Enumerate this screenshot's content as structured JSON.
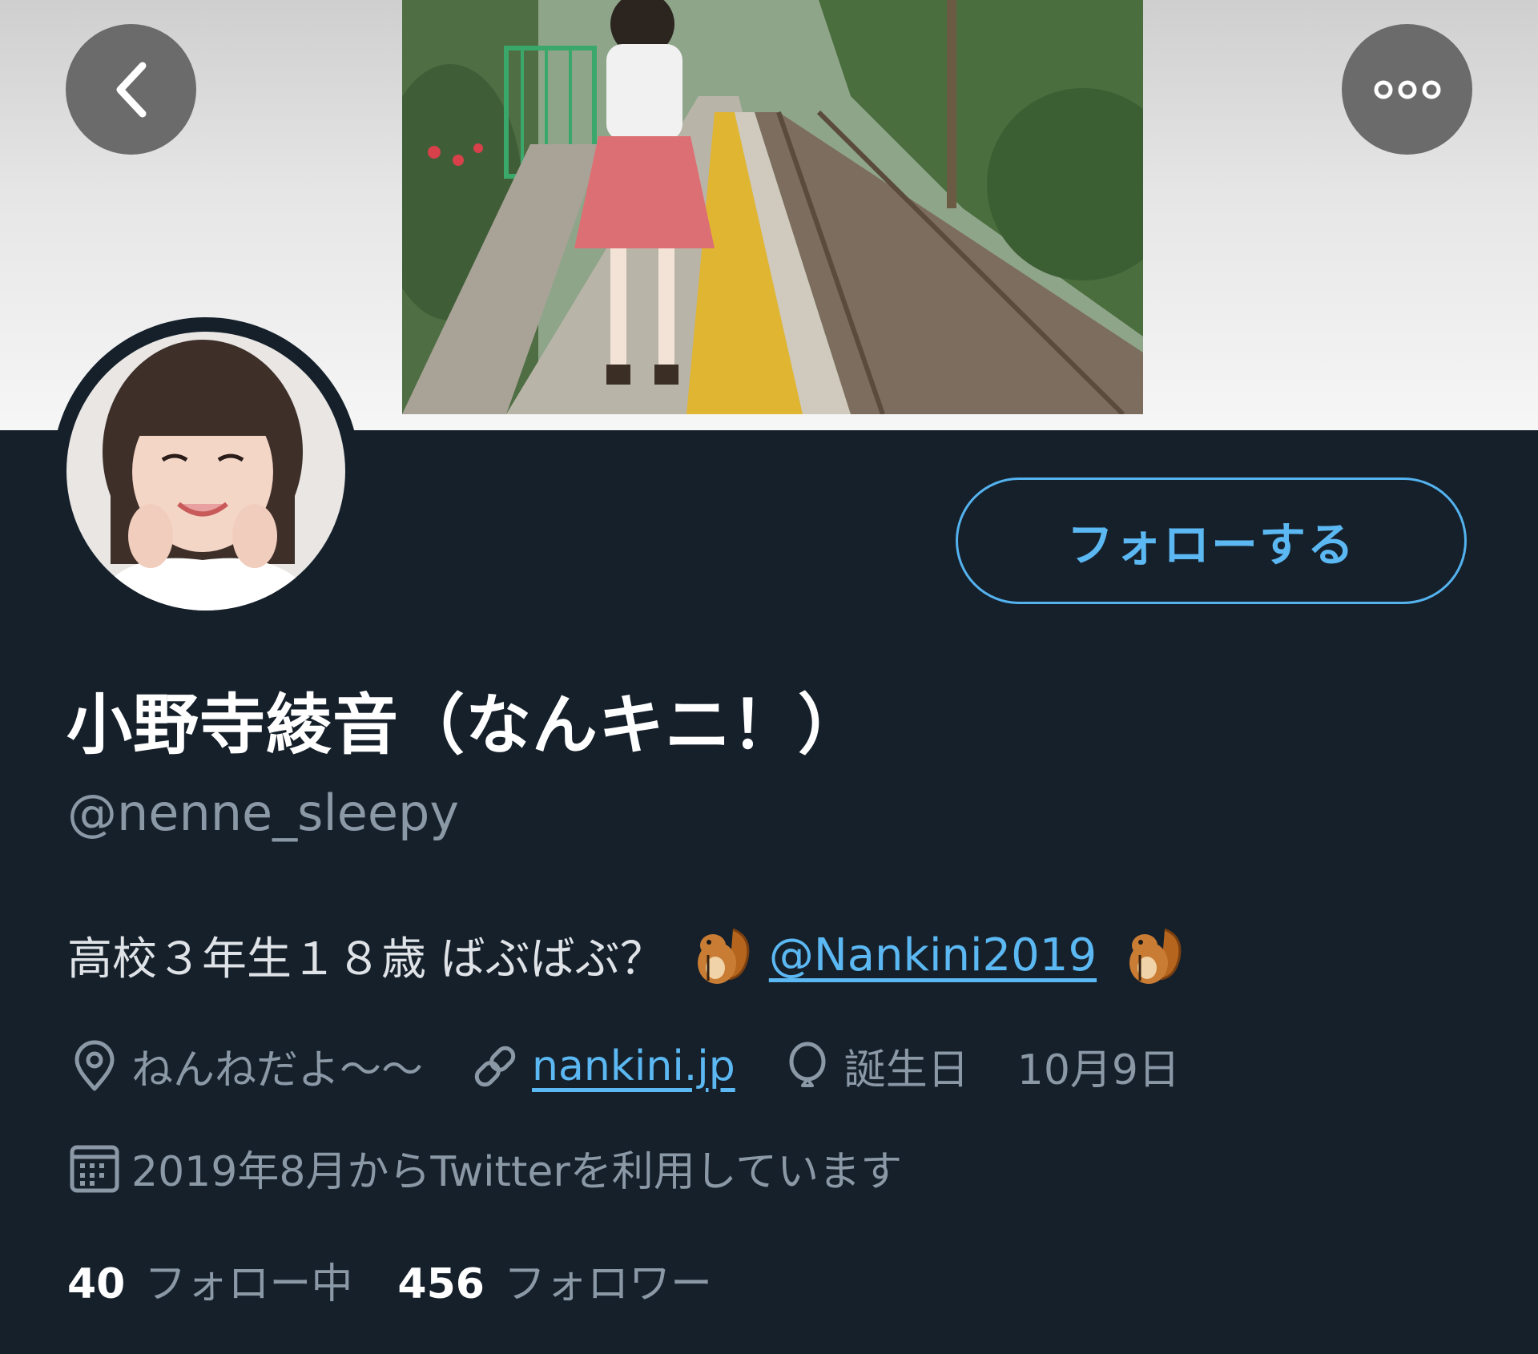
{
  "profile": {
    "display_name": "小野寺綾音（なんキニ！）",
    "handle": "@nenne_sleepy",
    "bio_text": "高校３年生１８歳 ばぶばぶ？",
    "bio_link": "@Nankini2019",
    "bio_emoji": "chipmunk-emoji"
  },
  "actions": {
    "follow_label": "フォローする",
    "back_icon": "chevron-left-icon",
    "more_icon": "more-horizontal-icon"
  },
  "meta": {
    "location": "ねんねだよ〜〜",
    "website": "nankini.jp",
    "birthday_label": "誕生日",
    "birthday_value": "10月9日",
    "joined": "2019年8月からTwitterを利用しています"
  },
  "stats": {
    "following_count": "40",
    "following_label": "フォロー中",
    "followers_count": "456",
    "followers_label": "フォロワー"
  },
  "colors": {
    "background": "#15202b",
    "accent": "#5cb8f2",
    "muted": "#8b98a5"
  }
}
